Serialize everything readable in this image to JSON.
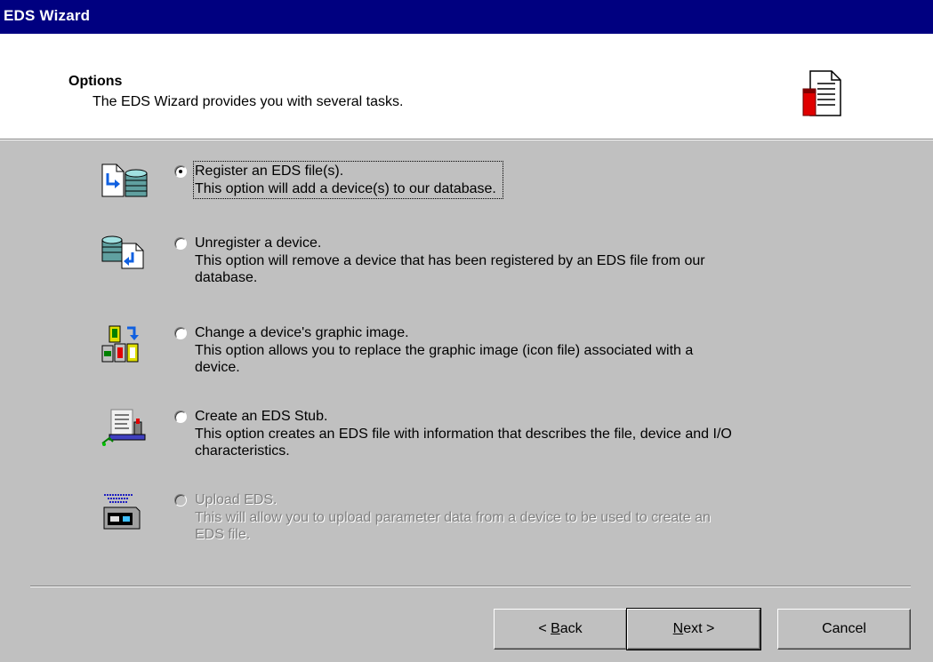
{
  "window": {
    "title": "EDS Wizard"
  },
  "header": {
    "title": "Options",
    "subtitle": "The EDS Wizard provides you with several tasks.",
    "icon": "document-icon"
  },
  "options": [
    {
      "icon": "register-eds-icon",
      "label": "Register an EDS file(s).",
      "description_lines": [
        "This option will add a device(s) to our database."
      ],
      "checked": true,
      "enabled": true
    },
    {
      "icon": "unregister-device-icon",
      "label": "Unregister a device.",
      "description_lines": [
        "This option will remove a device that has been registered by an EDS file from our",
        "database."
      ],
      "checked": false,
      "enabled": true
    },
    {
      "icon": "change-graphic-icon",
      "label": "Change a device's graphic image.",
      "description_lines": [
        "This option allows you to replace the graphic image (icon file) associated with a",
        "device."
      ],
      "checked": false,
      "enabled": true
    },
    {
      "icon": "create-stub-icon",
      "label": "Create an EDS Stub.",
      "description_lines": [
        "This option creates an EDS file with information that describes the file, device and I/O",
        "characteristics."
      ],
      "checked": false,
      "enabled": true
    },
    {
      "icon": "upload-eds-icon",
      "label": "Upload EDS.",
      "description_lines": [
        "This will allow you to upload parameter data from a device to be used to create an",
        "EDS file."
      ],
      "checked": false,
      "enabled": false
    }
  ],
  "buttons": {
    "back": {
      "prefix": "< ",
      "hotkey": "B",
      "rest": "ack"
    },
    "next": {
      "hotkey": "N",
      "rest": "ext >"
    },
    "cancel": "Cancel"
  }
}
